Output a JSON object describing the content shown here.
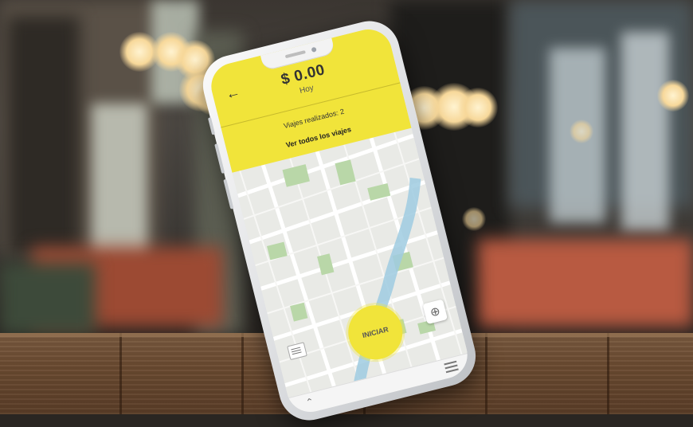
{
  "header": {
    "amount": "$ 0.00",
    "period": "Hoy",
    "trips_text": "Viajes realizados: 2",
    "view_all_label": "Ver todos los viajes"
  },
  "map": {
    "start_button_label": "INICIAR"
  },
  "colors": {
    "accent": "#f1e43a",
    "map_background": "#e9eae6",
    "park": "#b9d7a8",
    "water": "#9fcbe0"
  },
  "icons": {
    "back": "arrow-left-icon",
    "locate": "crosshair-icon",
    "legend": "list-icon",
    "up": "chevron-up-icon",
    "menu": "hamburger-menu-icon"
  }
}
